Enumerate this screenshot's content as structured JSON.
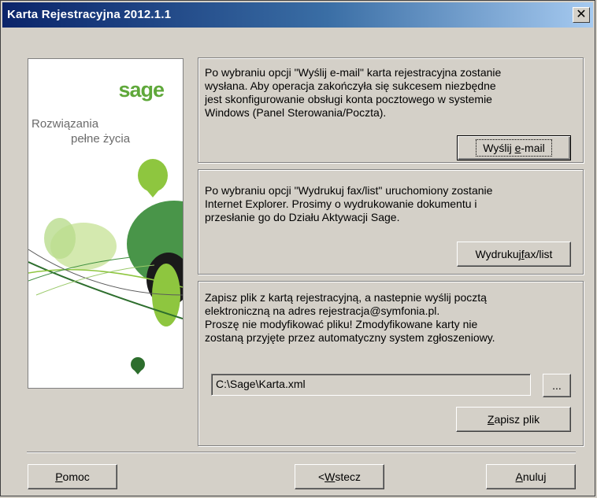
{
  "window": {
    "title": "Karta Rejestracyjna 2012.1.1",
    "close_glyph": "✕"
  },
  "logo": {
    "brand": "sage",
    "tagline_line1": "Rozwiązania",
    "tagline_line2": "pełne życia",
    "brand_color": "#5fa83a"
  },
  "email_section": {
    "lines": [
      "Po wybraniu opcji \"Wyślij e-mail\" karta rejestracyjna zostanie",
      "wysłana. Aby operacja zakończyła się sukcesem niezbędne",
      "jest skonfigurowanie obsługi konta pocztowego w systemie",
      "Windows (Panel Sterowania/Poczta)."
    ],
    "button_pre": "Wyślij ",
    "button_key": "e",
    "button_post": "-mail"
  },
  "fax_section": {
    "lines": [
      "Po wybraniu opcji \"Wydrukuj fax/list\" uruchomiony zostanie",
      "Internet Explorer. Prosimy o wydrukowanie dokumentu i",
      "przesłanie go do Działu Aktywacji Sage."
    ],
    "button_pre": "Wydrukuj ",
    "button_key": "f",
    "button_post": "ax/list"
  },
  "save_section": {
    "lines": [
      "Zapisz plik z kartą rejestracyjną, a nastepnie wyślij pocztą",
      "elektroniczną na adres rejestracja@symfonia.pl.",
      "Proszę nie modyfikować pliku! Zmodyfikowane karty nie",
      "zostaną przyjęte przez automatyczny system zgłoszeniowy."
    ],
    "path_value": "C:\\Sage\\Karta.xml",
    "browse_label": "...",
    "button_key": "Z",
    "button_post": "apisz plik"
  },
  "footer": {
    "help_key": "P",
    "help_post": "omoc",
    "back_pre": "< ",
    "back_key": "W",
    "back_post": "stecz",
    "cancel_key": "A",
    "cancel_post": "nuluj"
  },
  "colors": {
    "title_start": "#0a246a",
    "title_end": "#a6caf0",
    "face": "#d4d0c8"
  }
}
